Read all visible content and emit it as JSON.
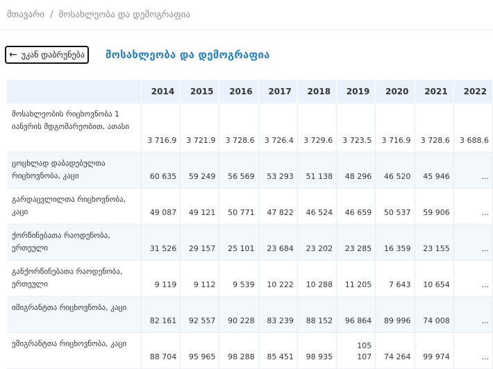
{
  "breadcrumb": {
    "home": "მთავარი",
    "separator": "/",
    "current": "მოსახლეობა და დემოგრაფია"
  },
  "header": {
    "back_label": "უკან დაბრუნება",
    "back_icon": "arrow-left-icon",
    "title": "მოსახლეობა და დემოგრაფია"
  },
  "table": {
    "years": [
      "2014",
      "2015",
      "2016",
      "2017",
      "2018",
      "2019",
      "2020",
      "2021",
      "2022"
    ],
    "rows": [
      {
        "label": "მოსახლეობის რიცხოვნობა 1 იანვრის მდგომარეობით, ათასი",
        "values": [
          "3 716.9",
          "3 721.9",
          "3 728.6",
          "3 726.4",
          "3 729.6",
          "3 723.5",
          "3 716.9",
          "3 728.6",
          "3 688.6"
        ]
      },
      {
        "label": "ცოცხლად დაბადებულთა რიცხოვნობა, კაცი",
        "values": [
          "60 635",
          "59 249",
          "56 569",
          "53 293",
          "51 138",
          "48 296",
          "46 520",
          "45 946",
          "..."
        ]
      },
      {
        "label": "გარდაცვლილთა რიცხოვნობა, კაცი",
        "values": [
          "49 087",
          "49 121",
          "50 771",
          "47 822",
          "46 524",
          "46 659",
          "50 537",
          "59 906",
          "..."
        ]
      },
      {
        "label": "ქორწინებათა რაოდენობა, ერთეული",
        "values": [
          "31 526",
          "29 157",
          "25 101",
          "23 684",
          "23 202",
          "23 285",
          "16 359",
          "23 155",
          "..."
        ]
      },
      {
        "label": "განქორწინებათა რაოდენობა, ერთეული",
        "values": [
          "9 119",
          "9 112",
          "9 539",
          "10 222",
          "10 288",
          "11 205",
          "7 643",
          "10 654",
          "..."
        ]
      },
      {
        "label": "იმიგრანტთა რიცხოვნობა, კაცი",
        "values": [
          "82 161",
          "92 557",
          "90 228",
          "83 239",
          "88 152",
          "96 864",
          "89 996",
          "74 008",
          "..."
        ]
      },
      {
        "label": "ემიგრანტთა რიცხოვნობა, კაცი",
        "values": [
          "88 704",
          "95 965",
          "98 288",
          "85 451",
          "98 935",
          "105\n107",
          "74 264",
          "99 974",
          "..."
        ]
      }
    ]
  }
}
